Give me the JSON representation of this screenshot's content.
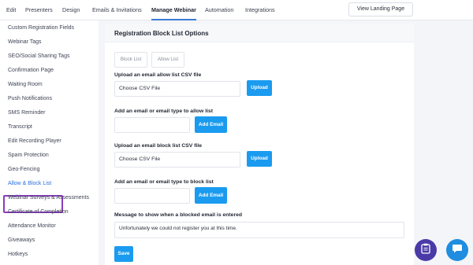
{
  "tabs": [
    {
      "label": "Edit"
    },
    {
      "label": "Presenters"
    },
    {
      "label": "Design"
    },
    {
      "label": "Emails & Invitations"
    },
    {
      "label": "Manage Webinar"
    },
    {
      "label": "Automation"
    },
    {
      "label": "Integrations"
    }
  ],
  "landing_button": "View Landing Page",
  "sidebar": {
    "items": [
      {
        "label": "Custom Registration Fields"
      },
      {
        "label": "Webinar Tags"
      },
      {
        "label": "SEO/Social Sharing Tags"
      },
      {
        "label": "Confirmation Page"
      },
      {
        "label": "Waiting Room"
      },
      {
        "label": "Push Notifications"
      },
      {
        "label": "SMS Reminder"
      },
      {
        "label": "Transcript"
      },
      {
        "label": "Edit Recording Player"
      },
      {
        "label": "Spam Protection"
      },
      {
        "label": "Geo-Fencing"
      },
      {
        "label": "Allow & Block List"
      },
      {
        "label": "Webinar Surveys & Assessments"
      },
      {
        "label": "Certificate of Completion"
      },
      {
        "label": "Attendance Monitor"
      },
      {
        "label": "Giveaways"
      },
      {
        "label": "Hotkeys"
      }
    ]
  },
  "panel": {
    "title": "Registration Block List Options",
    "block_list_tab": "Block List",
    "allow_list_tab": "Allow List",
    "allow_csv_label": "Upload an email allow list CSV file",
    "allow_csv_placeholder": "Choose CSV File",
    "allow_upload_button": "Upload",
    "allow_email_label": "Add an email or email type to allow list",
    "allow_add_button": "Add Email",
    "block_csv_label": "Upload an email block list CSV file",
    "block_csv_placeholder": "Choose CSV File",
    "block_upload_button": "Upload",
    "block_email_label": "Add an email or email type to block list",
    "block_add_button": "Add Email",
    "message_label": "Message to show when a blocked email is entered",
    "message_value": "Unfortunately we could not register you at this time.",
    "save_button": "Save"
  },
  "colors": {
    "accent": "#1a9bf0",
    "highlight": "#8a3bbf",
    "chat_fab": "#1f8de0",
    "notes_fab": "#4a3aa8"
  }
}
